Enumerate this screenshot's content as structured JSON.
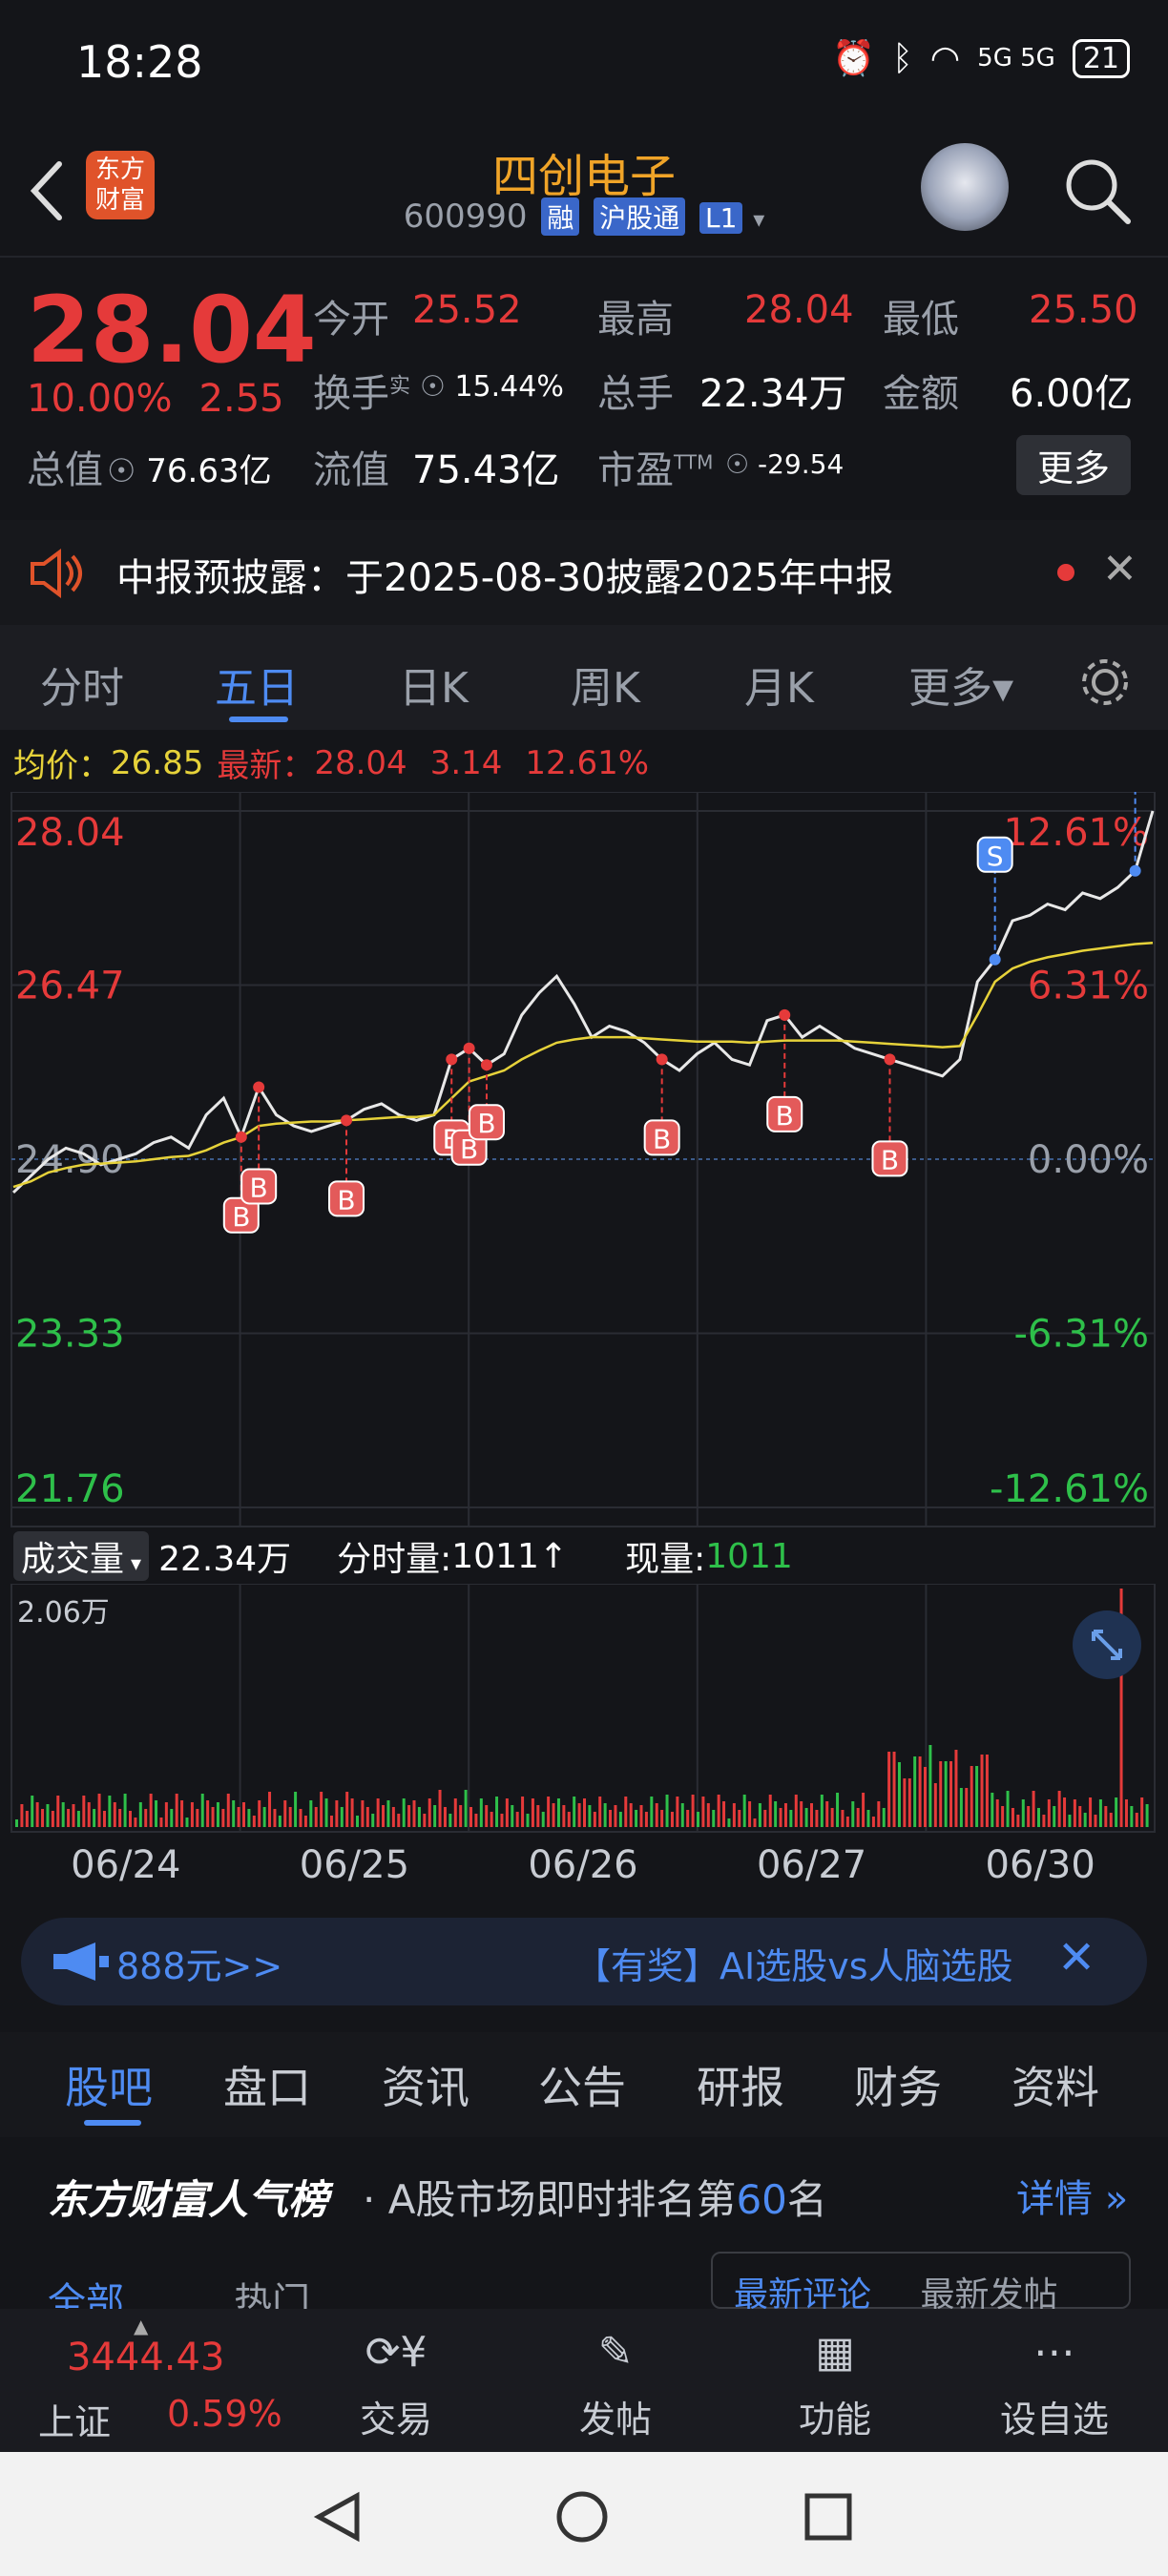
{
  "status_bar": {
    "time": "18:28",
    "battery": "21",
    "net": "5G 5G"
  },
  "header": {
    "title": "四创电子",
    "code": "600990",
    "tags": [
      "融",
      "沪股通",
      "L1"
    ],
    "logo_text": "东方财富"
  },
  "quote": {
    "price": "28.04",
    "change_pct": "10.00%",
    "change": "2.55",
    "open_label": "今开",
    "open": "25.52",
    "high_label": "最高",
    "high": "28.04",
    "low_label": "最低",
    "low": "25.50",
    "turnover_label": "换手",
    "turnover_sup": "实",
    "turnover": "15.44%",
    "volume_label": "总手",
    "volume": "22.34万",
    "amount_label": "金额",
    "amount": "6.00亿",
    "mcap_label": "总值",
    "mcap": "76.63亿",
    "float_label": "流值",
    "float": "75.43亿",
    "pe_label": "市盈",
    "pe_sup": "TTM",
    "pe": "-29.54",
    "more_label": "更多"
  },
  "notice": {
    "text": "中报预披露：于2025-08-30披露2025年中报"
  },
  "tabs": [
    "分时",
    "五日",
    "日K",
    "周K",
    "月K",
    "更多▾"
  ],
  "active_tab": "五日",
  "chart_header": {
    "avg_label": "均价：",
    "avg": "26.85",
    "latest_label": "最新：",
    "latest": "28.04",
    "change": "3.14",
    "pct": "12.61%"
  },
  "chart_data": {
    "type": "line",
    "x": [
      "06/24",
      "06/25",
      "06/26",
      "06/27",
      "06/30"
    ],
    "y_ticks_left": [
      "28.04",
      "26.47",
      "24.90",
      "23.33",
      "21.76"
    ],
    "y_ticks_right": [
      "12.61%",
      "6.31%",
      "0.00%",
      "-6.31%",
      "-12.61%"
    ],
    "ylim": [
      21.76,
      28.04
    ],
    "series": [
      {
        "values": [
          24.6,
          24.75,
          24.9,
          25.0,
          24.95,
          24.85,
          24.9,
          24.95,
          25.05,
          25.1,
          25.0,
          25.3,
          25.45,
          25.1,
          25.55,
          25.3,
          25.2,
          25.15,
          25.2,
          25.25,
          25.35,
          25.4,
          25.3,
          25.25,
          25.3,
          25.8,
          25.9,
          25.75,
          25.85,
          26.2,
          26.4,
          26.55,
          26.3,
          26.0,
          26.1,
          26.05,
          25.95,
          25.8,
          25.7,
          25.85,
          25.95,
          25.8,
          25.75,
          26.15,
          26.2,
          26.0,
          26.1,
          26.0,
          25.9,
          25.85,
          25.8,
          25.75,
          25.7,
          25.65,
          25.8,
          26.5,
          26.7,
          27.05,
          27.1,
          27.2,
          27.15,
          27.3,
          27.25,
          27.35,
          27.5,
          28.04
        ]
      },
      {
        "values": [
          24.65,
          24.7,
          24.78,
          24.82,
          24.85,
          24.86,
          24.87,
          24.88,
          24.9,
          24.92,
          24.93,
          24.98,
          25.05,
          25.1,
          25.2,
          25.22,
          25.23,
          25.24,
          25.24,
          25.25,
          25.26,
          25.27,
          25.28,
          25.28,
          25.3,
          25.45,
          25.6,
          25.65,
          25.7,
          25.8,
          25.88,
          25.95,
          25.98,
          26.0,
          26.0,
          26.0,
          25.99,
          25.98,
          25.97,
          25.96,
          25.96,
          25.96,
          25.95,
          25.96,
          25.97,
          25.97,
          25.97,
          25.97,
          25.96,
          25.95,
          25.94,
          25.93,
          25.92,
          25.91,
          25.92,
          26.2,
          26.5,
          26.62,
          26.68,
          26.72,
          26.75,
          26.78,
          26.8,
          26.82,
          26.84,
          26.85
        ]
      }
    ],
    "volume_max_label": "2.06万"
  },
  "trade_markers": {
    "b": "B",
    "s": "S"
  },
  "volume_info": {
    "type_label": "成交量",
    "total": "22.34万",
    "tick_label": "分时量:",
    "tick": "1011",
    "tick_arrow": "↑",
    "now_label": "现量:",
    "now": "1011"
  },
  "banner": {
    "left_text": "888元>>",
    "right_text": "【有奖】AI选股vs人脑选股"
  },
  "sub_tabs": [
    "股吧",
    "盘口",
    "资讯",
    "公告",
    "研报",
    "财务",
    "资料"
  ],
  "rank": {
    "brand": "东方财富人气榜",
    "text_a": "· A股市场即时排名第",
    "rank": "60",
    "text_b": "名",
    "detail": "详情"
  },
  "filter": {
    "all": "全部",
    "hot": "热门",
    "newest_comment": "最新评论",
    "newest_post": "最新发帖"
  },
  "bottom_bar": {
    "index_value": "3444.43",
    "index_name": "上证",
    "index_pct": "0.59%",
    "items": [
      "交易",
      "发帖",
      "功能",
      "设自选"
    ]
  }
}
